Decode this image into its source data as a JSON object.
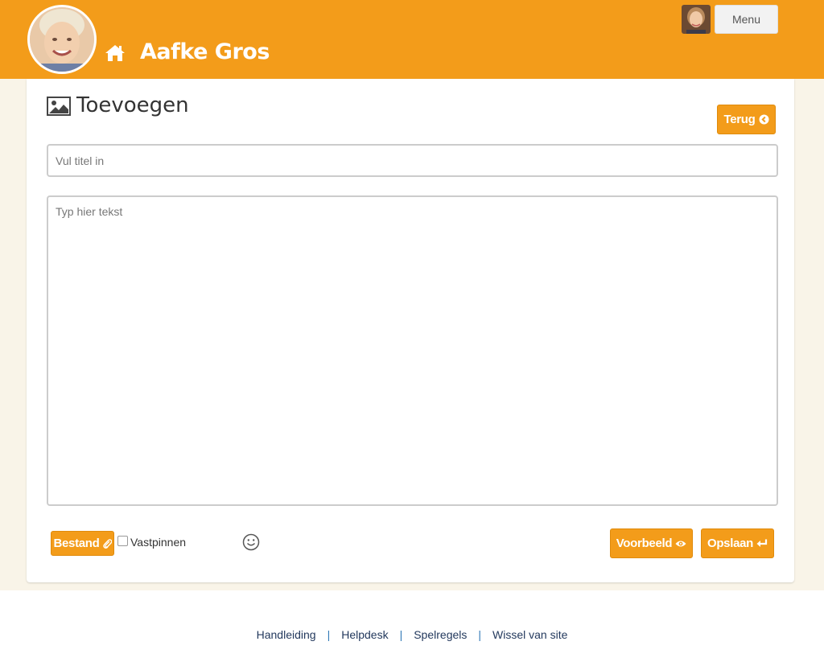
{
  "header": {
    "site_title": "Aafke Gros",
    "menu_label": "Menu",
    "accent_color": "#f39c1a",
    "icons": {
      "home": "home-icon",
      "avatar": "avatar"
    }
  },
  "editor": {
    "title": "Toevoegen",
    "back_label": "Terug",
    "title_placeholder": "Vul titel in",
    "text_placeholder": "Typ hier tekst",
    "file_label": "Bestand",
    "pin_label": "Vastpinnen",
    "pin_checked": false,
    "preview_label": "Voorbeeld",
    "save_label": "Opslaan"
  },
  "footer": {
    "links": [
      "Handleiding",
      "Helpdesk",
      "Spelregels",
      "Wissel van site"
    ],
    "separator": "|"
  }
}
